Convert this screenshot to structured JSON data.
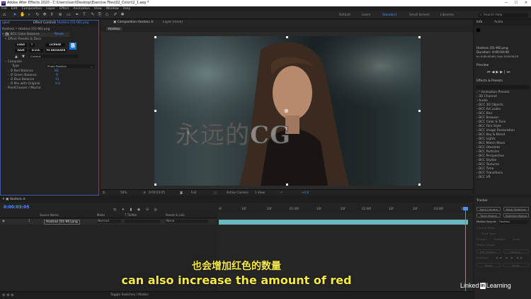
{
  "titlebar": {
    "app_icon": "Ae",
    "title": "Adobe After Effects 2020 - C:\\Users\\luerl\\Desktop\\Exercise Files\\02_Colori\\2_1.aep *",
    "minimize": "—",
    "maximize": "☐",
    "close": "✕"
  },
  "menubar": [
    "File",
    "Edit",
    "Composition",
    "Layer",
    "Effect",
    "Animation",
    "View",
    "Window",
    "Help"
  ],
  "toolbar": {
    "snapping": "Snapping",
    "workspaces": [
      "Default",
      "Learn",
      "Standard",
      "Small Screen",
      "Libraries"
    ],
    "active_workspace": "Standard",
    "search_placeholder": "Search Help"
  },
  "left_panel": {
    "tab_project": "oject",
    "tab_effect_controls": "Effect Controls",
    "tab_effect_file": "Hostess [01-96].png",
    "breadcrumb": "Hostess • Hostess [01-96].png",
    "effect_name": "BCC Color Balance",
    "reset": "Reset",
    "presets_label": "Effect Presets & Docs",
    "btns": [
      "LOAD",
      "?",
      "LICENSE",
      "SAVE",
      "H.V.D.",
      "FX BROWSER"
    ],
    "logo": "B",
    "preset_value": "Current",
    "rows": [
      {
        "label": "Compute",
        "value": ""
      },
      {
        "label": "Type",
        "value": "Photo Positive"
      },
      {
        "label": "Red Balance",
        "value": "66"
      },
      {
        "label": "Green Balance",
        "value": "0"
      },
      {
        "label": "Blue Balance",
        "value": "11"
      },
      {
        "label": "Mix with Original",
        "value": "0.0"
      },
      {
        "label": "PixelChooser / Mocha",
        "value": ""
      }
    ]
  },
  "comp_panel": {
    "tab": "Composition Hostess",
    "layer_tab": "Layer (none)",
    "comp_name": "Hostess",
    "watermark": "永远的CG"
  },
  "viewer_controls": {
    "zoom": "50%",
    "timecode": "0:00:03:05",
    "resolution": "Full",
    "camera": "Active Camera",
    "views": "1 View",
    "exposure": "+0.0"
  },
  "right_panel": {
    "info_tab": "Info",
    "audio_tab": "Audio",
    "info_lines": [
      "Hostess [01-96].png",
      "Duration: 0:00:04:00",
      "In: 0:00:00:00, Out: 0:00:03:23"
    ],
    "preview_label": "Preview",
    "effects_label": "Effects & Presets",
    "effects_items": [
      "* Animation Presets",
      "3D Channel",
      "Audio",
      "BCC 3D Objects",
      "BCC Art Looks",
      "BCC Blur",
      "BCC Browser",
      "BCC Color & Tone",
      "BCC Film Style",
      "BCC Image Restoration",
      "BCC Key & Blend",
      "BCC Lights",
      "BCC Match Move",
      "BCC Obsolete",
      "BCC Particles",
      "BCC Perspective",
      "BCC Stylize",
      "BCC Textures",
      "BCC Time",
      "BCC Transitions",
      "BCC VR"
    ]
  },
  "timeline": {
    "tab": "Hostess",
    "timecode": "0:00:03:05",
    "col_source": "Source Name",
    "col_mode": "Mode",
    "col_trkmat": "T TrkMat",
    "col_parent": "Parent & Link",
    "layer_num": "1",
    "layer_name": "Hostess [01-96].png",
    "layer_mode": "Normal",
    "layer_parent": "None",
    "ruler": [
      "0f",
      "10f",
      "20f",
      "01:00f",
      "10f",
      "20f",
      "02:00f",
      "10f",
      "20f",
      "03:00f",
      "10f"
    ],
    "status": "Toggle Switches / Modes"
  },
  "tracker": {
    "label": "Tracker",
    "buttons": [
      "Track Camera",
      "Warp Stabilizer",
      "Track Motion",
      "Stabilize Motion"
    ],
    "motion_source_label": "Motion Source:",
    "motion_source": "Hostess",
    "rows": [
      "Current Track:",
      "Track Type:",
      "Position",
      "Rotation",
      "Scale",
      "Motion Target:",
      "Edit Target...",
      "Options...",
      "Analyze:",
      "Reset",
      "Apply"
    ]
  },
  "subtitles": {
    "zh": "也会增加红色的数量",
    "en": "can also increase the amount of red"
  },
  "brand": {
    "pre": "Linked",
    "in": "in",
    "post": "Learning"
  },
  "colors": {
    "accent": "#4d91ff",
    "layer_bar": "#6bb8c2",
    "subtitle": "#f5e94a",
    "bcc_blue": "#1a7ad8"
  }
}
